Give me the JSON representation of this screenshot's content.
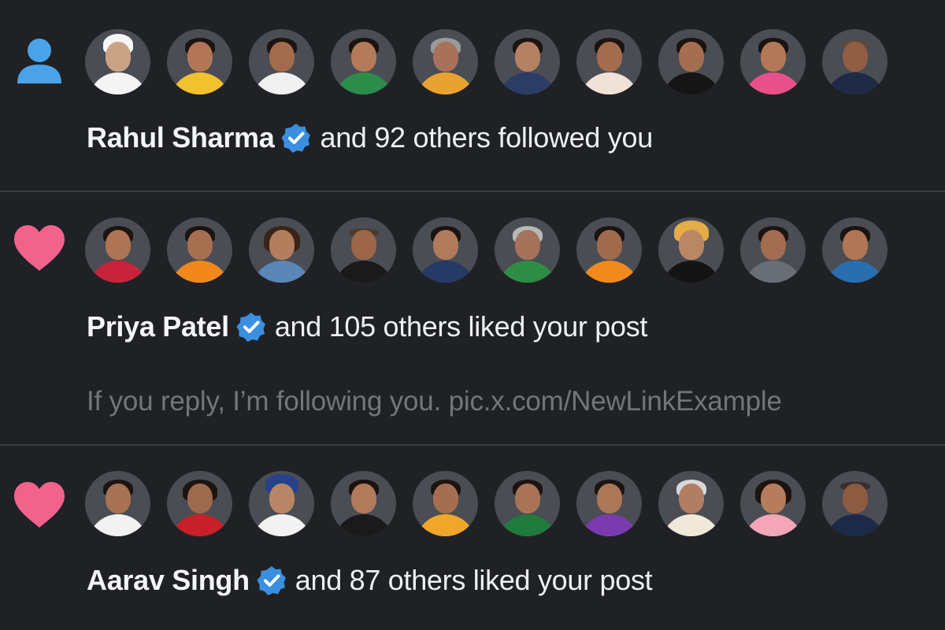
{
  "notifications": [
    {
      "type_icon": "person-icon",
      "actor_name": "Rahul Sharma",
      "verified_icon": "verified-badge-icon",
      "action_text": "and 92 others followed you",
      "avatar_count": 10
    },
    {
      "type_icon": "heart-icon",
      "actor_name": "Priya Patel",
      "verified_icon": "verified-badge-icon",
      "action_text": "and 105 others liked your post",
      "post_text": "If you reply, I’m following you. pic.x.com/NewLinkExample",
      "avatar_count": 10
    },
    {
      "type_icon": "heart-icon",
      "actor_name": "Aarav Singh",
      "verified_icon": "verified-badge-icon",
      "action_text": "and 87 others liked your post",
      "avatar_count": 10
    }
  ],
  "colors": {
    "background": "#1f2125",
    "divider": "#3a3d44",
    "primary_text": "#eef0f3",
    "secondary_text": "#71767b",
    "follow_icon": "#1d9bf0",
    "like_icon": "#f2638c",
    "verified_badge": "#1d9bf0"
  }
}
